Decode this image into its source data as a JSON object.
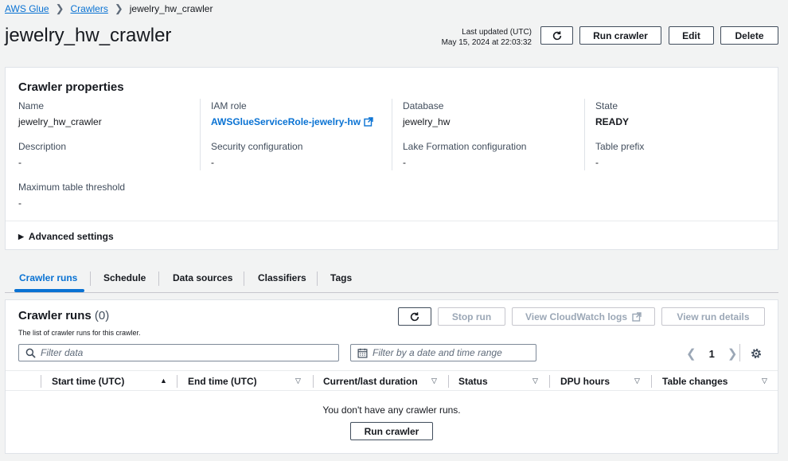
{
  "breadcrumb": {
    "items": [
      "AWS Glue",
      "Crawlers"
    ],
    "current": "jewelry_hw_crawler"
  },
  "header": {
    "title": "jewelry_hw_crawler",
    "last_updated_label": "Last updated (UTC)",
    "last_updated_value": "May 15, 2024 at 22:03:32",
    "run_crawler": "Run crawler",
    "edit": "Edit",
    "delete": "Delete"
  },
  "properties": {
    "title": "Crawler properties",
    "name_label": "Name",
    "name_value": "jewelry_hw_crawler",
    "iam_label": "IAM role",
    "iam_value": "AWSGlueServiceRole-jewelry-hw",
    "db_label": "Database",
    "db_value": "jewelry_hw",
    "state_label": "State",
    "state_value": "READY",
    "desc_label": "Description",
    "desc_value": "-",
    "sec_label": "Security configuration",
    "sec_value": "-",
    "lf_label": "Lake Formation configuration",
    "lf_value": "-",
    "prefix_label": "Table prefix",
    "prefix_value": "-",
    "max_label": "Maximum table threshold",
    "max_value": "-",
    "advanced": "Advanced settings"
  },
  "tabs": [
    "Crawler runs",
    "Schedule",
    "Data sources",
    "Classifiers",
    "Tags"
  ],
  "runs": {
    "title": "Crawler runs",
    "count": "(0)",
    "description": "The list of crawler runs for this crawler.",
    "stop_run": "Stop run",
    "cloudwatch": "View CloudWatch logs",
    "view_details": "View run details",
    "filter_placeholder": "Filter data",
    "date_placeholder": "Filter by a date and time range",
    "page": "1",
    "columns": [
      "Start time (UTC)",
      "End time (UTC)",
      "Current/last duration",
      "Status",
      "DPU hours",
      "Table changes"
    ],
    "empty_text": "You don't have any crawler runs.",
    "empty_button": "Run crawler"
  }
}
